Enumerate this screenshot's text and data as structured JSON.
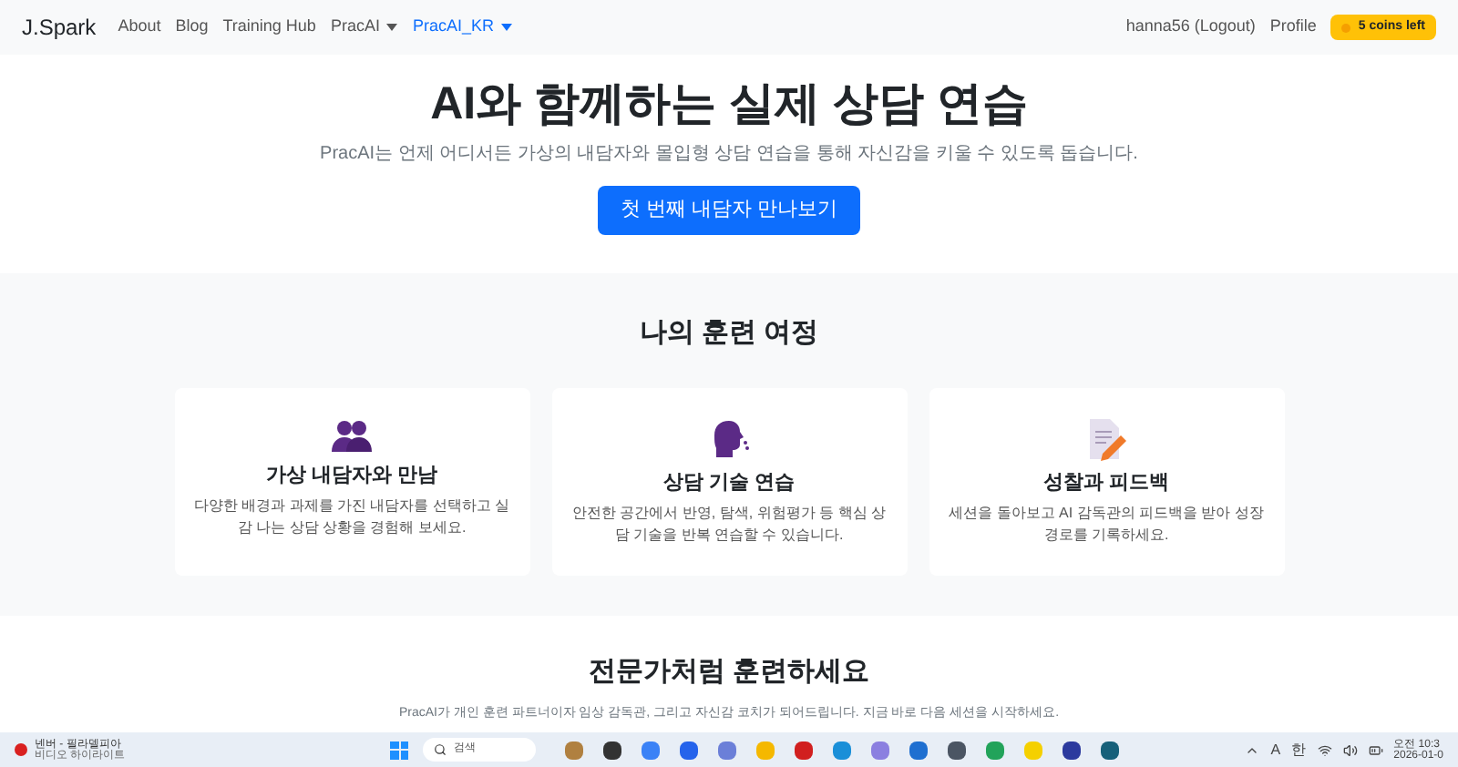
{
  "navbar": {
    "brand": "J.Spark",
    "links": [
      {
        "label": "About",
        "dropdown": false,
        "selected": false
      },
      {
        "label": "Blog",
        "dropdown": false,
        "selected": false
      },
      {
        "label": "Training Hub",
        "dropdown": false,
        "selected": false
      },
      {
        "label": "PracAI",
        "dropdown": true,
        "selected": false
      },
      {
        "label": "PracAI_KR",
        "dropdown": true,
        "selected": true
      }
    ],
    "user": "hanna56 (Logout)",
    "profile": "Profile",
    "coins": "5 coins left"
  },
  "hero": {
    "title": "AI와 함께하는 실제 상담 연습",
    "subtitle": "PracAI는 언제 어디서든 가상의 내담자와 몰입형 상담 연습을 통해 자신감을 키울 수 있도록 돕습니다.",
    "button": "첫 번째 내담자 만나보기"
  },
  "journey": {
    "title": "나의 훈련 여정",
    "cards": [
      {
        "kind": "people",
        "title": "가상 내담자와 만남",
        "text": "다양한 배경과 과제를 가진 내담자를 선택하고 실감 나는 상담 상황을 경험해 보세요."
      },
      {
        "kind": "speaking",
        "title": "상담 기술 연습",
        "text": "안전한 공간에서 반영, 탐색, 위험평가 등 핵심 상담 기술을 반복 연습할 수 있습니다."
      },
      {
        "kind": "memo",
        "title": "성찰과 피드백",
        "text": "세션을 돌아보고 AI 감독관의 피드백을 받아 성장 경로를 기록하세요."
      }
    ]
  },
  "pro": {
    "title": "전문가처럼 훈련하세요",
    "text": "PracAI가 개인 훈련 파트너이자 임상 감독관, 그리고 자신감 코치가 되어드립니다. 지금 바로 다음 세션을 시작하세요."
  },
  "taskbar": {
    "widget_title": "넨버 - 필라델피아",
    "widget_subtitle": "비디오 하이라이트",
    "search_placeholder": "검색",
    "lang_a": "A",
    "lang_han": "한",
    "time": "오전 10:3",
    "date": "2026-01-0"
  }
}
